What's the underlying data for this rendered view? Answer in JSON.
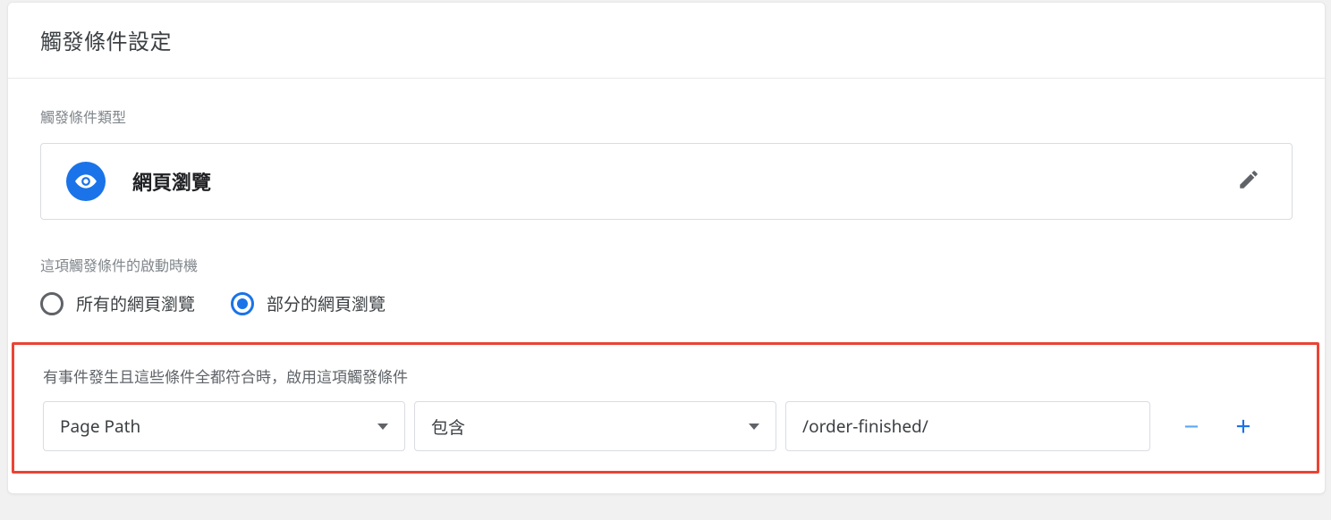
{
  "header": {
    "title": "觸發條件設定"
  },
  "type_section": {
    "label": "觸發條件類型",
    "selected_type": "網頁瀏覽"
  },
  "fires_on": {
    "label": "這項觸發條件的啟動時機",
    "options": {
      "all": {
        "label": "所有的網頁瀏覽",
        "checked": false
      },
      "some": {
        "label": "部分的網頁瀏覽",
        "checked": true
      }
    }
  },
  "conditions": {
    "label": "有事件發生且這些條件全都符合時，啟用這項觸發條件",
    "rows": [
      {
        "variable": "Page Path",
        "operator": "包含",
        "value": "/order-finished/"
      }
    ]
  },
  "glyphs": {
    "minus": "−",
    "plus": "+"
  }
}
